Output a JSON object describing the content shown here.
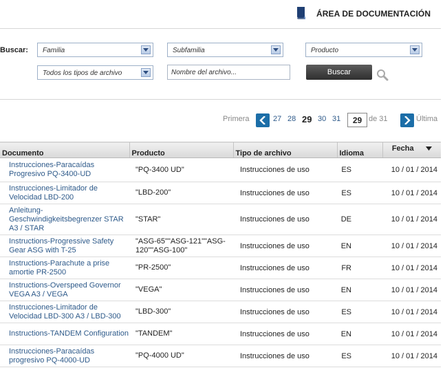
{
  "header": {
    "title": "ÁREA DE DOCUMENTACIÓN",
    "icon": "book-icon"
  },
  "search": {
    "label": "Buscar:",
    "familia": "Familia",
    "subfamilia": "Subfamilia",
    "producto": "Producto",
    "tipo_archivo": "Todos los tipos de archivo",
    "nombre_placeholder": "Nombre del archivo...",
    "button_label": "Buscar"
  },
  "pagination": {
    "first": "Primera",
    "pages": [
      "27",
      "28",
      "29",
      "30",
      "31"
    ],
    "current": "29",
    "input_value": "29",
    "of_label": "de 31",
    "last": "Última"
  },
  "table": {
    "headers": [
      "Documento",
      "Producto",
      "Tipo de archivo",
      "Idioma",
      "Fecha"
    ],
    "rows": [
      {
        "documento": "Instrucciones-Paracaídas Progresivo PQ-3400-UD",
        "producto": "\"PQ-3400 UD\"",
        "tipo": "Instrucciones de uso",
        "idioma": "ES",
        "fecha": "10 / 01 / 2014"
      },
      {
        "documento": "Instrucciones-Limitador de Velocidad LBD-200",
        "producto": "\"LBD-200\"",
        "tipo": "Instrucciones de uso",
        "idioma": "ES",
        "fecha": "10 / 01 / 2014"
      },
      {
        "documento": "Anleitung-Geschwindigkeitsbegrenzer STAR A3 / STAR",
        "producto": "\"STAR\"",
        "tipo": "Instrucciones de uso",
        "idioma": "DE",
        "fecha": "10 / 01 / 2014"
      },
      {
        "documento": "Instructions-Progressive Safety Gear ASG with T-25",
        "producto": "\"ASG-65\"\"ASG-121\"\"ASG-120\"\"ASG-100\"",
        "tipo": "Instrucciones de uso",
        "idioma": "EN",
        "fecha": "10 / 01 / 2014"
      },
      {
        "documento": "Instructions-Parachute a prise amortie PR-2500",
        "producto": "\"PR-2500\"",
        "tipo": "Instrucciones de uso",
        "idioma": "FR",
        "fecha": "10 / 01 / 2014"
      },
      {
        "documento": "Instructions-Overspeed Governor VEGA A3 / VEGA",
        "producto": "\"VEGA\"",
        "tipo": "Instrucciones de uso",
        "idioma": "EN",
        "fecha": "10 / 01 / 2014"
      },
      {
        "documento": "Instrucciones-Limitador de Velocidad LBD-300 A3 / LBD-300",
        "producto": "\"LBD-300\"",
        "tipo": "Instrucciones de uso",
        "idioma": "ES",
        "fecha": "10 / 01 / 2014"
      },
      {
        "documento": "Instructions-TANDEM Configuration",
        "producto": "\"TANDEM\"",
        "tipo": "Instrucciones de uso",
        "idioma": "EN",
        "fecha": "10 / 01 / 2014"
      },
      {
        "documento": "Instrucciones-Paracaídas progresivo PQ-4000-UD",
        "producto": "\"PQ-4000 UD\"",
        "tipo": "Instrucciones de uso",
        "idioma": "ES",
        "fecha": "10 / 01 / 2014"
      }
    ]
  },
  "colors": {
    "accent": "#1c6ea8",
    "link": "#2e5a8a",
    "header_icon": "#1f3f73"
  }
}
